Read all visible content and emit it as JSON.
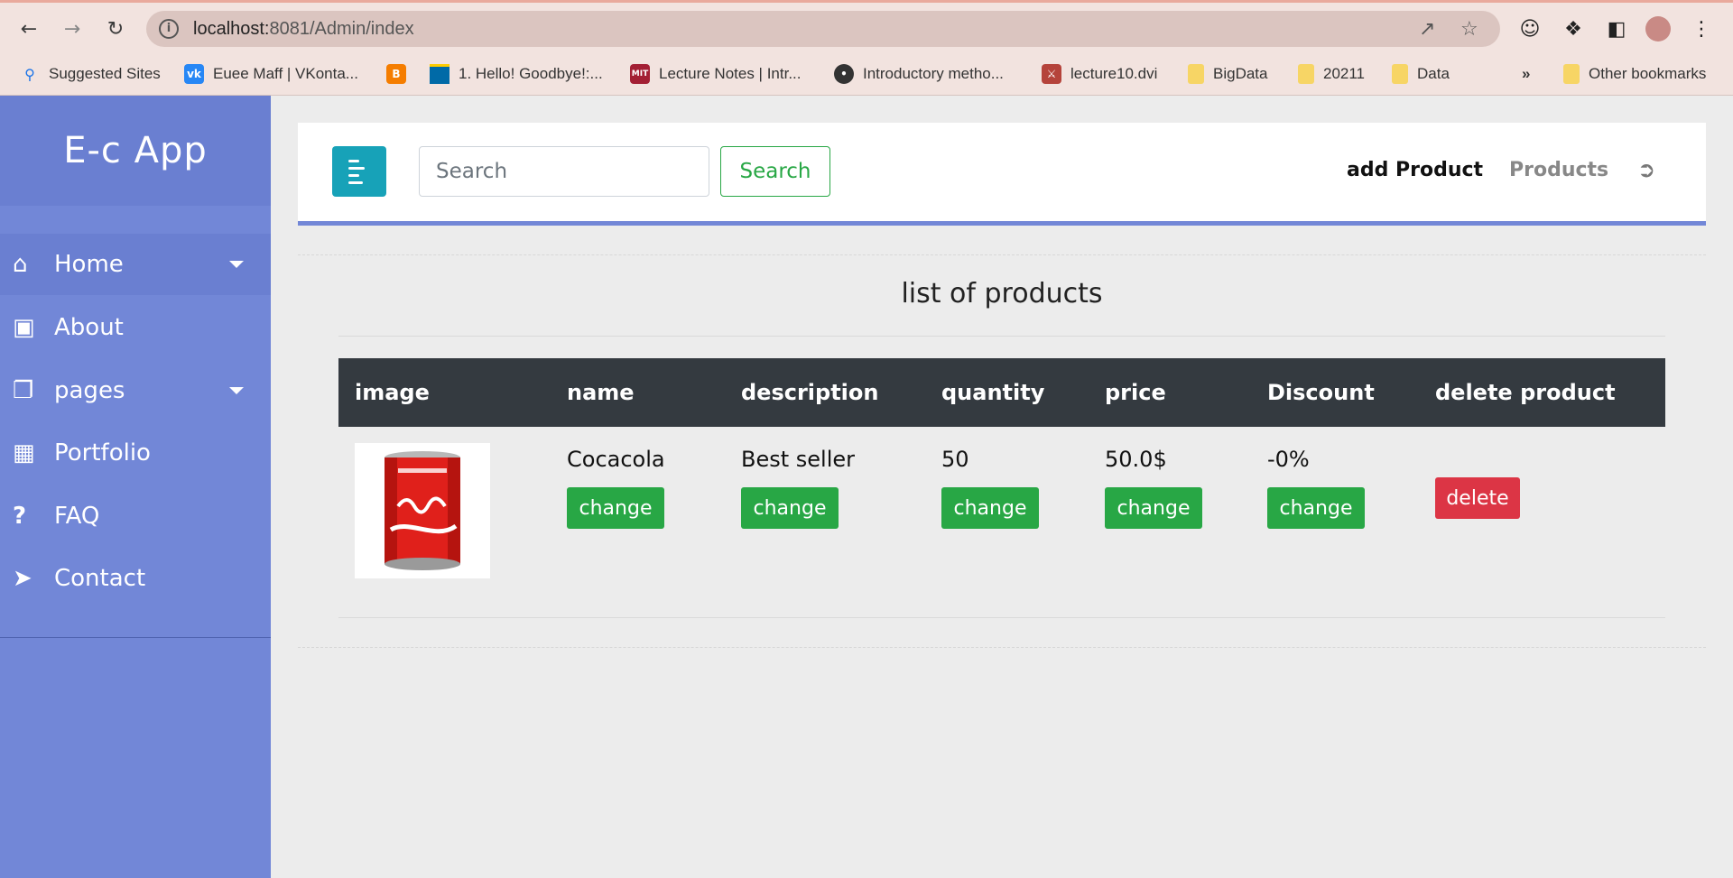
{
  "browser": {
    "url_host": "localhost:",
    "url_rest": "8081/Admin/index",
    "bookmarks": [
      {
        "label": "Suggested Sites",
        "icon": "search-icon"
      },
      {
        "label": "Euee Maff | VKonta...",
        "icon": "vk-icon"
      },
      {
        "label": "",
        "icon": "blogger-icon"
      },
      {
        "label": "1. Hello! Goodbye!:...",
        "icon": "sweden-flag-icon"
      },
      {
        "label": "Lecture Notes | Intr...",
        "icon": "mit-ocw-icon"
      },
      {
        "label": "Introductory metho...",
        "icon": "globe-icon"
      },
      {
        "label": "lecture10.dvi",
        "icon": "crest-icon"
      },
      {
        "label": "BigData",
        "icon": "folder-icon"
      },
      {
        "label": "20211",
        "icon": "folder-icon"
      },
      {
        "label": "Data",
        "icon": "folder-icon"
      }
    ],
    "overflow": "»",
    "other_bookmarks": "Other bookmarks"
  },
  "sidebar": {
    "brand": "E-c App",
    "items": [
      {
        "label": "Home",
        "icon": "home-icon",
        "has_caret": true,
        "active": true
      },
      {
        "label": "About",
        "icon": "briefcase-icon",
        "has_caret": false
      },
      {
        "label": "pages",
        "icon": "copy-icon",
        "has_caret": true
      },
      {
        "label": "Portfolio",
        "icon": "image-icon",
        "has_caret": false
      },
      {
        "label": "FAQ",
        "icon": "question-icon",
        "has_caret": false
      },
      {
        "label": "Contact",
        "icon": "paper-plane-icon",
        "has_caret": false
      }
    ]
  },
  "navbar": {
    "search_placeholder": "Search",
    "search_button": "Search",
    "add_product": "add Product",
    "products": "Products",
    "signout_icon": "sign-out-icon"
  },
  "main": {
    "heading": "list of products",
    "columns": [
      "image",
      "name",
      "description",
      "quantity",
      "price",
      "Discount",
      "delete product"
    ],
    "rows": [
      {
        "image": "coca-cola-can",
        "name": "Cocacola",
        "description": "Best seller",
        "quantity": "50",
        "price": "50.0$",
        "discount": "-0%",
        "change_label": "change",
        "delete_label": "delete"
      }
    ]
  },
  "colors": {
    "sidebar": "#7287d7",
    "sidebar_header": "#6a7fd1",
    "toggle": "#17a2b8",
    "success": "#28a745",
    "danger": "#dc3545",
    "table_head": "#343a40"
  }
}
